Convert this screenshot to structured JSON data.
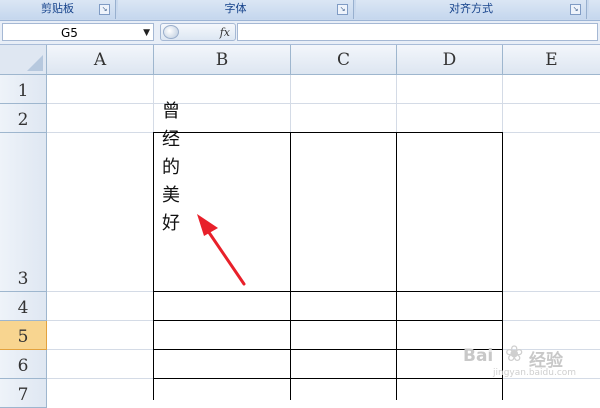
{
  "ribbon": {
    "groups": [
      {
        "label": "剪贴板"
      },
      {
        "label": "字体"
      },
      {
        "label": "对齐方式"
      }
    ]
  },
  "formula_bar": {
    "name_box_value": "G5",
    "fx_label": "fx",
    "formula_value": ""
  },
  "grid": {
    "columns": [
      "A",
      "B",
      "C",
      "D",
      "E"
    ],
    "rows": [
      "1",
      "2",
      "3",
      "4",
      "5",
      "6",
      "7"
    ],
    "selected_row": "5",
    "cell_B3": {
      "chars": [
        "曾",
        "经",
        "的",
        "美",
        "好"
      ],
      "text": "曾经的美好"
    }
  },
  "annotation": {
    "arrow_color": "#e8202a"
  },
  "watermark": {
    "left": "Bai",
    "right": "经验",
    "sub": "jingyan.baidu.com"
  }
}
